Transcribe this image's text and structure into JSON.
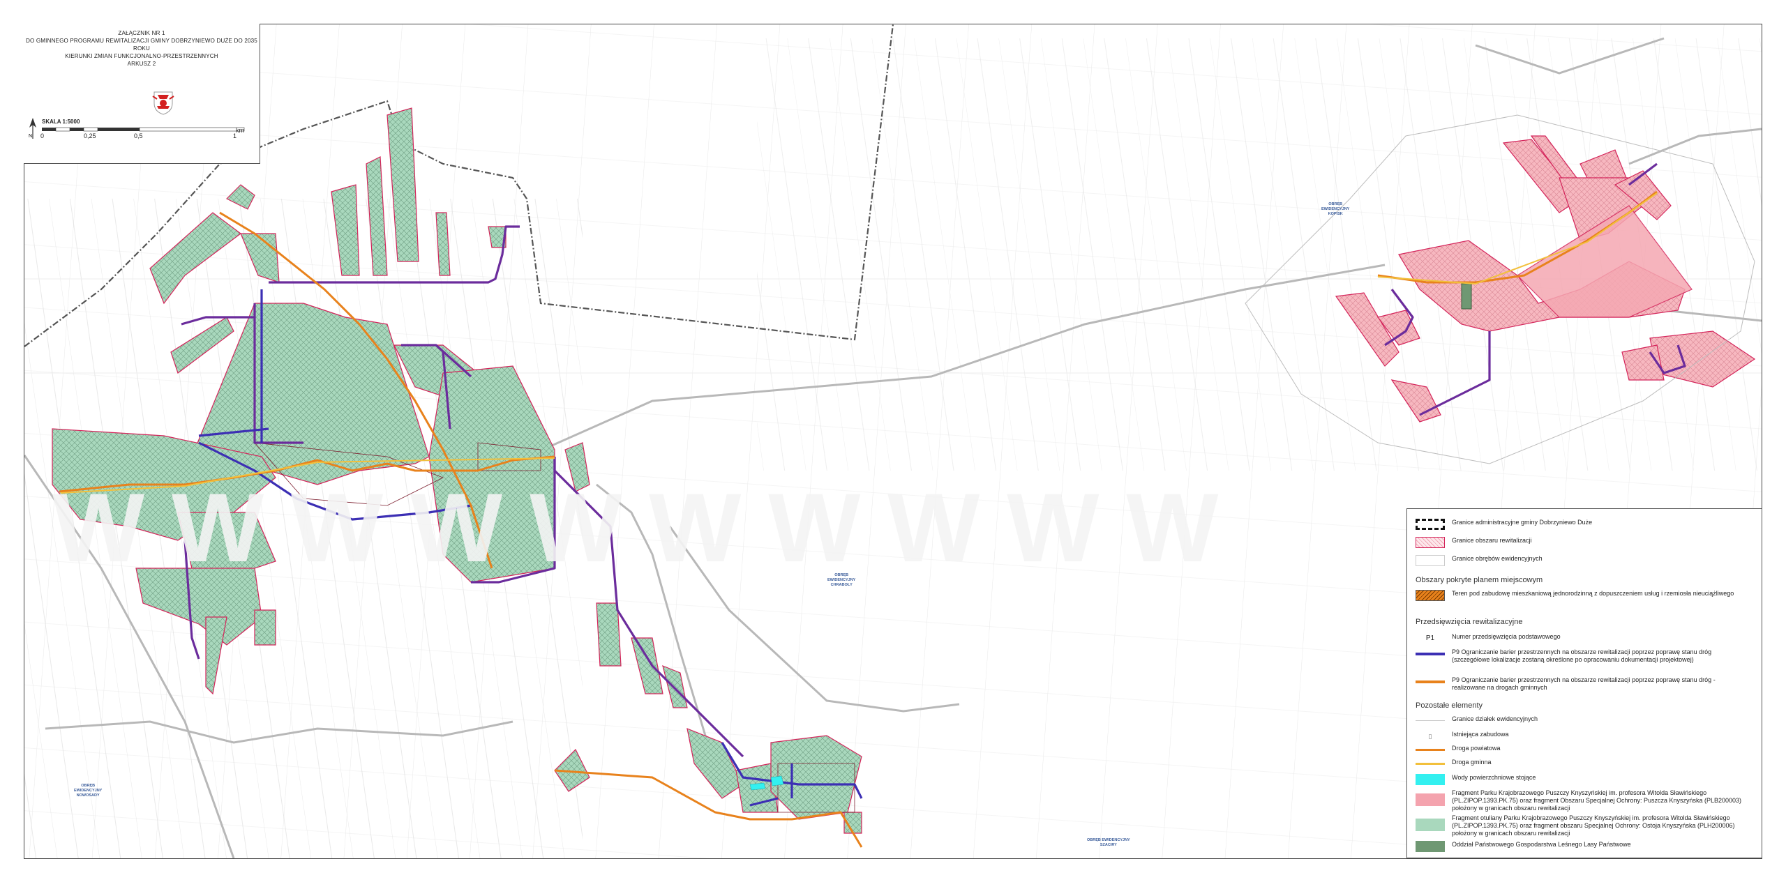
{
  "title_block": {
    "lines": [
      "ZAŁĄCZNIK NR 1",
      "DO GMINNEGO PROGRAMU REWITALIZACJI GMINY DOBRZYNIEWO DUŻE DO 2035 ROKU",
      "KIERUNKI ZMIAN FUNKCJONALNO-PRZESTRZENNYCH",
      "ARKUSZ 2"
    ],
    "scale_label": "SKALA 1:5000",
    "scale_ticks": [
      "0",
      "0,25",
      "0,5",
      "1"
    ],
    "scale_unit": "km"
  },
  "place_labels": [
    {
      "id": "obreb-kopisk",
      "lines": [
        "OBRĘB",
        "EWIDENCYJNY",
        "KOPISK"
      ]
    },
    {
      "id": "obreb-chraboly",
      "lines": [
        "OBRĘB",
        "EWIDENCYJNY",
        "CHRABOŁY"
      ]
    },
    {
      "id": "obreb-nowosady",
      "lines": [
        "OBRĘB",
        "EWIDENCYJNY",
        "NOWOSADY"
      ]
    },
    {
      "id": "obreb-szaciry",
      "lines": [
        "OBRĘB EWIDENCYJNY",
        "SZACIRY"
      ]
    }
  ],
  "legend": {
    "items_top": [
      {
        "icon": "admin-boundary-swatch",
        "text": "Granice administracyjne gminy Dobrzyniewo Duże"
      },
      {
        "icon": "revitalization-boundary-swatch",
        "text": "Granice obszaru rewitalizacji"
      },
      {
        "icon": "survey-area-boundary-swatch",
        "text": "Granice obrębów ewidencyjnych"
      }
    ],
    "section_plan": "Obszary pokryte planem miejscowym",
    "plan_item": {
      "icon": "hatched-orange-swatch",
      "text": "Teren pod zabudowę mieszkaniową jednorodzinną z dopuszczeniem usług i rzemiosła nieuciążliwego"
    },
    "section_projects": "Przedsięwzięcia rewitalizacyjne",
    "project_items": [
      {
        "icon": "p1-number-symbol",
        "symbol": "P1",
        "text": "Numer przedsięwzięcia podstawowego"
      },
      {
        "icon": "purple-line-swatch",
        "text": "P9 Ograniczanie barier przestrzennych na obszarze rewitalizacji poprzez poprawę stanu dróg (szczegółowe lokalizacje zostaną określone po opracowaniu dokumentacji projektowej)"
      },
      {
        "icon": "orange-line-swatch",
        "text": "P9 Ograniczanie barier przestrzennych na obszarze rewitalizacji poprzez poprawę stanu dróg - realizowane na drogach gminnych"
      }
    ],
    "section_other": "Pozostałe elementy",
    "other_items": [
      {
        "icon": "parcel-line-swatch",
        "text": "Granice działek ewidencyjnych"
      },
      {
        "icon": "building-symbol",
        "text": "Istniejąca zabudowa"
      },
      {
        "icon": "district-road-swatch",
        "text": "Droga powiatowa"
      },
      {
        "icon": "municipal-road-swatch",
        "text": "Droga gminna"
      },
      {
        "icon": "water-swatch",
        "text": "Wody powierzchniowe stojące"
      },
      {
        "icon": "pink-area-swatch",
        "text": "Fragment Parku Krajobrazowego Puszczy Knyszyńskiej im. profesora Witolda Sławińskiego (PL.ZIPOP.1393.PK.75) oraz fragment Obszaru Specjalnej Ochrony: Puszcza Knyszyńska (PLB200003) położony w granicach obszaru rewitalizacji"
      },
      {
        "icon": "green-area-swatch",
        "text": "Fragment otuliany Parku Krajobrazowego Puszczy Knyszyńskiej im. profesora Witolda Sławińskiego (PL.ZIPOP.1393.PK.75) oraz fragment obszaru Specjalnej Ochrony: Ostoja Knyszyńska (PLH200006) położony w granicach obszaru rewitalizacji"
      },
      {
        "icon": "forest-division-swatch",
        "text": "Oddział Państwowego Gospodarstwa Leśnego Lasy Państwowe"
      }
    ]
  },
  "colors": {
    "revitalization_boundary": "#d4245a",
    "green_fill": "#a9d8bd",
    "pink_fill": "#f4a3ae",
    "purple_road": "#6b2c9c",
    "blue_road": "#3c2fb4",
    "district_road": "#e8821c",
    "municipal_road": "#f2c03c",
    "water": "#33f0f0",
    "forest_division": "#6f9873",
    "parcel_lines": "#c9c9c9"
  }
}
